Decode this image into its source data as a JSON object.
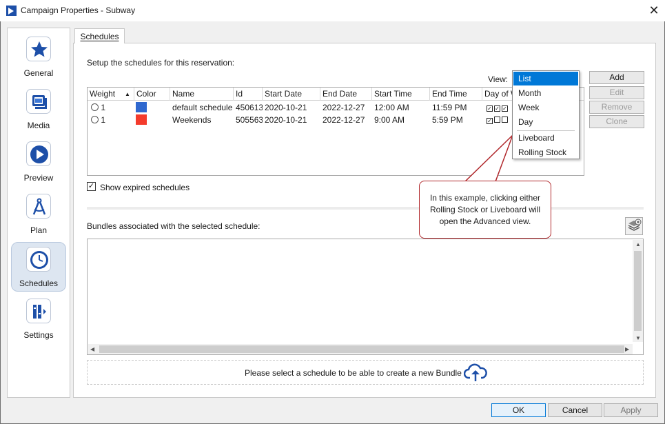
{
  "window": {
    "title": "Campaign Properties - Subway"
  },
  "sidebar": {
    "items": [
      {
        "label": "General",
        "icon": "star-icon"
      },
      {
        "label": "Media",
        "icon": "media-icon"
      },
      {
        "label": "Preview",
        "icon": "play-icon"
      },
      {
        "label": "Plan",
        "icon": "compass-icon"
      },
      {
        "label": "Schedules",
        "icon": "clock-icon",
        "active": true
      },
      {
        "label": "Settings",
        "icon": "settings-icon"
      }
    ]
  },
  "tab": {
    "label": "Schedules"
  },
  "schedules": {
    "instruction": "Setup the schedules for this reservation:",
    "view_label": "View:",
    "columns": [
      "Weight",
      "Color",
      "Name",
      "Id",
      "Start Date",
      "End Date",
      "Start Time",
      "End Time",
      "Day of W"
    ],
    "rows": [
      {
        "weight": "1",
        "color": "#2f68cf",
        "name": "default schedule",
        "id": "450613",
        "start_date": "2020-10-21",
        "end_date": "2022-12-27",
        "start_time": "12:00 AM",
        "end_time": "11:59 PM"
      },
      {
        "weight": "1",
        "color": "#f43b2c",
        "name": "Weekends",
        "id": "505563",
        "start_date": "2020-10-21",
        "end_date": "2022-12-27",
        "start_time": "9:00 AM",
        "end_time": "5:59 PM"
      }
    ],
    "buttons": {
      "add": "Add",
      "edit": "Edit",
      "remove": "Remove",
      "clone": "Clone"
    },
    "show_expired": "Show expired schedules"
  },
  "view_menu": {
    "items": [
      "List",
      "Month",
      "Week",
      "Day",
      "Liveboard",
      "Rolling Stock"
    ],
    "selected": "List"
  },
  "callout": {
    "text": "In this example, clicking either Rolling Stock or Liveboard will open the Advanced view."
  },
  "bundles": {
    "label": "Bundles associated with the selected schedule:",
    "empty_message": "Please select a schedule to be able to create a new Bundle"
  },
  "footer": {
    "ok": "OK",
    "cancel": "Cancel",
    "apply": "Apply"
  },
  "colors": {
    "accent": "#0078d7",
    "callout_border": "#b0262a",
    "icon_blue": "#1d4fa8"
  }
}
